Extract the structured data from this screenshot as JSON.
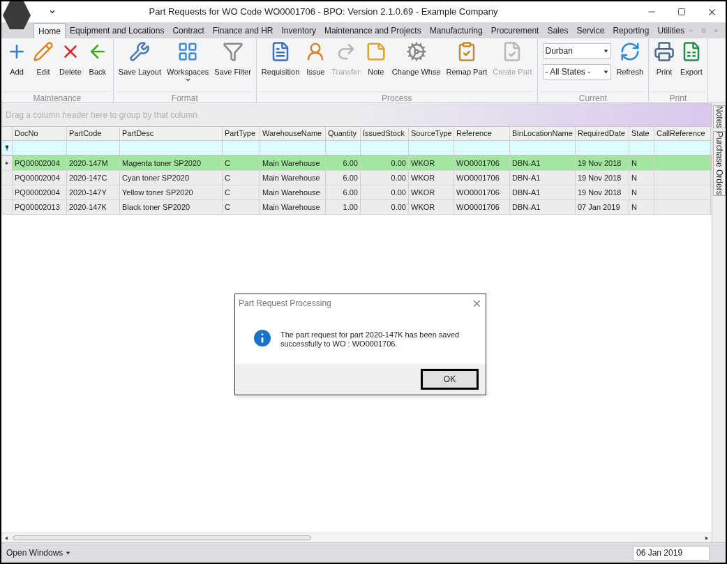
{
  "window": {
    "title": "Part Requests for WO Code WO0001706 - BPO: Version 2.1.0.69 - Example Company"
  },
  "tabs": [
    {
      "label": "Home",
      "selected": true
    },
    {
      "label": "Equipment and Locations",
      "selected": false
    },
    {
      "label": "Contract",
      "selected": false
    },
    {
      "label": "Finance and HR",
      "selected": false
    },
    {
      "label": "Inventory",
      "selected": false
    },
    {
      "label": "Maintenance and Projects",
      "selected": false
    },
    {
      "label": "Manufacturing",
      "selected": false
    },
    {
      "label": "Procurement",
      "selected": false
    },
    {
      "label": "Sales",
      "selected": false
    },
    {
      "label": "Service",
      "selected": false
    },
    {
      "label": "Reporting",
      "selected": false
    },
    {
      "label": "Utilities",
      "selected": false
    }
  ],
  "ribbon": [
    {
      "name": "Maintenance",
      "buttons": [
        {
          "label": "Add",
          "disabled": false
        },
        {
          "label": "Edit",
          "disabled": false
        },
        {
          "label": "Delete",
          "disabled": false
        },
        {
          "label": "Back",
          "disabled": false
        }
      ]
    },
    {
      "name": "Format",
      "buttons": [
        {
          "label": "Save Layout",
          "disabled": false
        },
        {
          "label": "Workspaces",
          "disabled": false,
          "dropdown": true
        },
        {
          "label": "Save Filter",
          "disabled": false
        }
      ]
    },
    {
      "name": "Process",
      "buttons": [
        {
          "label": "Requisition",
          "disabled": false
        },
        {
          "label": "Issue",
          "disabled": false
        },
        {
          "label": "Transfer",
          "disabled": true
        },
        {
          "label": "Note",
          "disabled": false
        },
        {
          "label": "Change Whse",
          "disabled": false
        },
        {
          "label": "Remap Part",
          "disabled": false
        },
        {
          "label": "Create Part",
          "disabled": true
        }
      ]
    },
    {
      "name": "Current",
      "selects": [
        "Durban",
        "- All States -"
      ],
      "buttons": [
        {
          "label": "Refresh",
          "disabled": false
        }
      ]
    },
    {
      "name": "Print",
      "buttons": [
        {
          "label": "Print",
          "disabled": false
        },
        {
          "label": "Export",
          "disabled": false
        }
      ]
    }
  ],
  "group_panel": {
    "placeholder": "Drag a column header here to group by that column"
  },
  "table": {
    "columns": [
      {
        "label": "DocNo",
        "kind": "text"
      },
      {
        "label": "PartCode",
        "kind": "text"
      },
      {
        "label": "PartDesc",
        "kind": "text"
      },
      {
        "label": "PartType",
        "kind": "text"
      },
      {
        "label": "WarehouseName",
        "kind": "text"
      },
      {
        "label": "Quantity",
        "kind": "number"
      },
      {
        "label": "IssuedStock",
        "kind": "number"
      },
      {
        "label": "SourceType",
        "kind": "text"
      },
      {
        "label": "Reference",
        "kind": "text"
      },
      {
        "label": "BinLocationName",
        "kind": "text"
      },
      {
        "label": "RequiredDate",
        "kind": "text"
      },
      {
        "label": "State",
        "kind": "text"
      },
      {
        "label": "CallReference",
        "kind": "text"
      }
    ],
    "rows": [
      {
        "selected": true,
        "cells": [
          "PQ00002004",
          "2020-147M",
          "Magenta toner SP2020",
          "C",
          "Main Warehouse",
          "6.00",
          "0.00",
          "WKOR",
          "WO0001706",
          "DBN-A1",
          "19 Nov 2018",
          "N",
          ""
        ]
      },
      {
        "selected": false,
        "cells": [
          "PQ00002004",
          "2020-147C",
          "Cyan toner SP2020",
          "C",
          "Main Warehouse",
          "6.00",
          "0.00",
          "WKOR",
          "WO0001706",
          "DBN-A1",
          "19 Nov 2018",
          "N",
          ""
        ]
      },
      {
        "selected": false,
        "cells": [
          "PQ00002004",
          "2020-147Y",
          "Yellow toner SP2020",
          "C",
          "Main Warehouse",
          "6.00",
          "0.00",
          "WKOR",
          "WO0001706",
          "DBN-A1",
          "19 Nov 2018",
          "N",
          ""
        ]
      },
      {
        "selected": false,
        "cells": [
          "PQ00002013",
          "2020-147K",
          "Black toner SP2020",
          "C",
          "Main Warehouse",
          "1.00",
          "0.00",
          "WKOR",
          "WO0001706",
          "DBN-A1",
          "07 Jan 2019",
          "N",
          ""
        ]
      }
    ]
  },
  "side_tabs": [
    "Notes",
    "Purchase Orders"
  ],
  "dialog": {
    "title": "Part Request Processing",
    "message": "The part request for part 2020-147K has been saved successfully to WO : WO0001706.",
    "button": "OK"
  },
  "status_bar": {
    "menu": "Open Windows",
    "date": "06 Jan 2019"
  }
}
